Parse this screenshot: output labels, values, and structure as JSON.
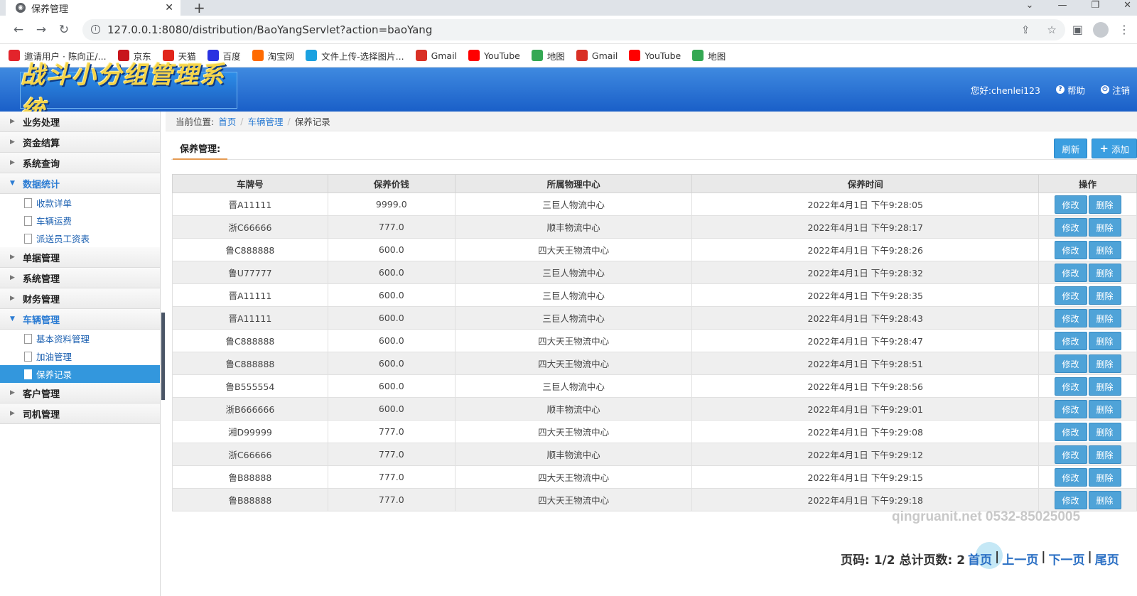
{
  "browser": {
    "tab_title": "保养管理",
    "url": "127.0.0.1:8080/distribution/BaoYangServlet?action=baoYang",
    "bookmarks": [
      {
        "label": "邀请用户 · 陈向正/...",
        "icon": "invite-icon",
        "color": "#e3242b"
      },
      {
        "label": "京东",
        "icon": "jd-icon",
        "color": "#c8161d"
      },
      {
        "label": "天猫",
        "icon": "tmall-icon",
        "color": "#e1251b"
      },
      {
        "label": "百度",
        "icon": "baidu-icon",
        "color": "#2932e1"
      },
      {
        "label": "淘宝网",
        "icon": "taobao-icon",
        "color": "#ff6a00"
      },
      {
        "label": "文件上传-选择图片...",
        "icon": "upload-icon",
        "color": "#1aa1e0"
      },
      {
        "label": "Gmail",
        "icon": "gmail-icon",
        "color": "#d93025"
      },
      {
        "label": "YouTube",
        "icon": "youtube-icon",
        "color": "#ff0000"
      },
      {
        "label": "地图",
        "icon": "maps-icon",
        "color": "#34a853"
      },
      {
        "label": "Gmail",
        "icon": "gmail-icon",
        "color": "#d93025"
      },
      {
        "label": "YouTube",
        "icon": "youtube-icon",
        "color": "#ff0000"
      },
      {
        "label": "地图",
        "icon": "maps-icon",
        "color": "#34a853"
      }
    ]
  },
  "header": {
    "logo_text": "战斗小分组管理系统",
    "greeting": "您好:chenlei123",
    "help": "帮助",
    "logout": "注销"
  },
  "sidebar": {
    "groups": [
      {
        "label": "业务处理",
        "open": false,
        "items": []
      },
      {
        "label": "资金结算",
        "open": false,
        "items": []
      },
      {
        "label": "系统查询",
        "open": false,
        "items": []
      },
      {
        "label": "数据统计",
        "open": true,
        "items": [
          "收款详单",
          "车辆运费",
          "派送员工资表"
        ]
      },
      {
        "label": "单据管理",
        "open": false,
        "items": []
      },
      {
        "label": "系统管理",
        "open": false,
        "items": []
      },
      {
        "label": "财务管理",
        "open": false,
        "items": []
      },
      {
        "label": "车辆管理",
        "open": true,
        "items": [
          "基本资料管理",
          "加油管理",
          "保养记录"
        ]
      },
      {
        "label": "客户管理",
        "open": false,
        "items": []
      },
      {
        "label": "司机管理",
        "open": false,
        "items": []
      }
    ],
    "active_item": "保养记录"
  },
  "breadcrumb": {
    "prefix": "当前位置:",
    "home": "首页",
    "section": "车辆管理",
    "current": "保养记录"
  },
  "toolbar": {
    "title": "保养管理:",
    "refresh": "刷新",
    "add": "添加"
  },
  "table": {
    "columns": [
      "车牌号",
      "保养价钱",
      "所属物理中心",
      "保养时间",
      "操作"
    ],
    "edit_label": "修改",
    "delete_label": "删除",
    "rows": [
      [
        "晋A11111",
        "9999.0",
        "三巨人物流中心",
        "2022年4月1日 下午9:28:05"
      ],
      [
        "浙C66666",
        "777.0",
        "顺丰物流中心",
        "2022年4月1日 下午9:28:17"
      ],
      [
        "鲁C888888",
        "600.0",
        "四大天王物流中心",
        "2022年4月1日 下午9:28:26"
      ],
      [
        "鲁U77777",
        "600.0",
        "三巨人物流中心",
        "2022年4月1日 下午9:28:32"
      ],
      [
        "晋A11111",
        "600.0",
        "三巨人物流中心",
        "2022年4月1日 下午9:28:35"
      ],
      [
        "晋A11111",
        "600.0",
        "三巨人物流中心",
        "2022年4月1日 下午9:28:43"
      ],
      [
        "鲁C888888",
        "600.0",
        "四大天王物流中心",
        "2022年4月1日 下午9:28:47"
      ],
      [
        "鲁C888888",
        "600.0",
        "四大天王物流中心",
        "2022年4月1日 下午9:28:51"
      ],
      [
        "鲁B555554",
        "600.0",
        "三巨人物流中心",
        "2022年4月1日 下午9:28:56"
      ],
      [
        "浙B666666",
        "600.0",
        "顺丰物流中心",
        "2022年4月1日 下午9:29:01"
      ],
      [
        "湘D99999",
        "777.0",
        "四大天王物流中心",
        "2022年4月1日 下午9:29:08"
      ],
      [
        "浙C66666",
        "777.0",
        "顺丰物流中心",
        "2022年4月1日 下午9:29:12"
      ],
      [
        "鲁B88888",
        "777.0",
        "四大天王物流中心",
        "2022年4月1日 下午9:29:15"
      ],
      [
        "鲁B88888",
        "777.0",
        "四大天王物流中心",
        "2022年4月1日 下午9:29:18"
      ]
    ]
  },
  "pager": {
    "info": "页码: 1/2 总计页数: 2",
    "first": "首页",
    "prev": "上一页",
    "next": "下一页",
    "last": "尾页"
  },
  "watermark": "qingruanit.net 0532-85025005"
}
